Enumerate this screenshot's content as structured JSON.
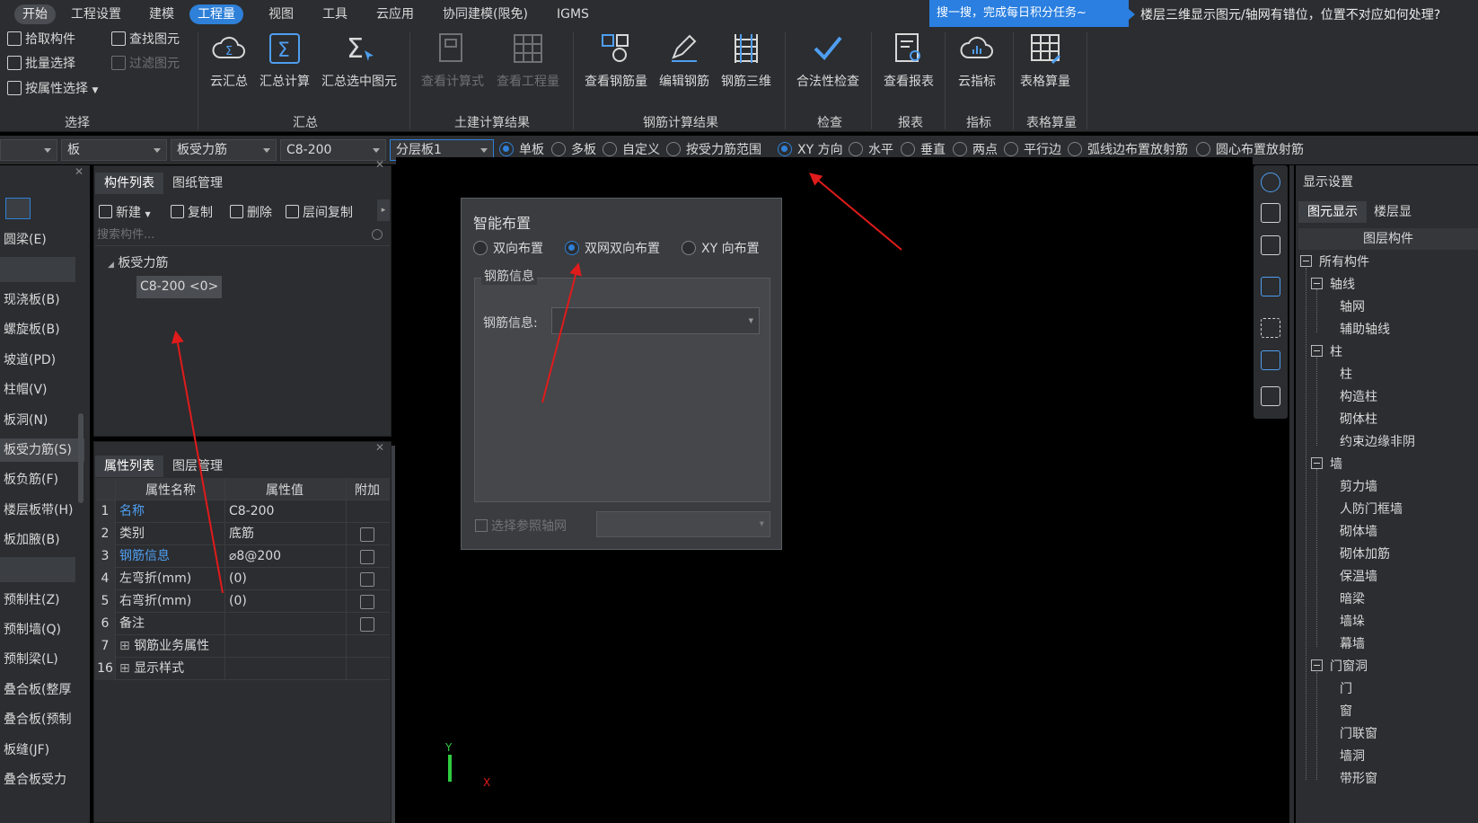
{
  "menubar": {
    "items": [
      "开始",
      "工程设置",
      "建模",
      "工程量",
      "视图",
      "工具",
      "云应用",
      "协同建模(限免)",
      "IGMS"
    ],
    "active": "工程量",
    "search_tip": "搜一搜，完成每日积分任务~",
    "question_text": "楼层三维显示图元/轴网有错位，位置不对应如何处理?"
  },
  "ribbon": {
    "select": {
      "pick": "拾取构件",
      "batch": "批量选择",
      "by_attr": "按属性选择",
      "find": "查找图元",
      "filter": "过滤图元",
      "label": "选择"
    },
    "summary": {
      "cloud": "云汇总",
      "calc": "汇总计算",
      "selected": "汇总选中图元",
      "label": "汇总"
    },
    "civil": {
      "formula": "查看计算式",
      "quantity": "查看工程量",
      "label": "土建计算结果"
    },
    "rebar": {
      "view_amount": "查看钢筋量",
      "edit": "编辑钢筋",
      "three_d": "钢筋三维",
      "label": "钢筋计算结果"
    },
    "check": {
      "legal": "合法性检查",
      "label": "检查"
    },
    "report": {
      "view": "查看报表",
      "label": "报表"
    },
    "index": {
      "cloud": "云指标",
      "label": "指标"
    },
    "table": {
      "calc": "表格算量",
      "label": "表格算量"
    }
  },
  "toolbar": {
    "combos": [
      "",
      "板",
      "板受力筋",
      "C8-200",
      "分层板1"
    ],
    "radios": [
      "单板",
      "多板",
      "自定义",
      "按受力筋范围",
      "XY 方向",
      "水平",
      "垂直",
      "两点",
      "平行边",
      "弧线边布置放射筋",
      "圆心布置放射筋"
    ],
    "radio_selected": [
      0,
      4
    ]
  },
  "leftnav": {
    "items": [
      "圆梁(E)",
      "现浇板(B)",
      "螺旋板(B)",
      "坡道(PD)",
      "柱帽(V)",
      "板洞(N)",
      "板受力筋(S)",
      "板负筋(F)",
      "楼层板带(H)",
      "板加腋(B)",
      "预制柱(Z)",
      "预制墙(Q)",
      "预制梁(L)",
      "叠合板(整厚",
      "叠合板(预制",
      "板缝(JF)",
      "叠合板受力"
    ],
    "selected": "板受力筋(S)"
  },
  "component_panel": {
    "tabs": [
      "构件列表",
      "图纸管理"
    ],
    "actions": {
      "new": "新建",
      "copy": "复制",
      "delete": "删除",
      "floor_copy": "层间复制"
    },
    "search_placeholder": "搜索构件...",
    "tree_root": "板受力筋",
    "tree_item": "C8-200 <0>"
  },
  "property_panel": {
    "tabs": [
      "属性列表",
      "图层管理"
    ],
    "headers": {
      "name": "属性名称",
      "value": "属性值",
      "extra": "附加"
    },
    "rows": [
      {
        "no": "1",
        "name": "名称",
        "value": "C8-200",
        "blue": true,
        "check": false
      },
      {
        "no": "2",
        "name": "类别",
        "value": "底筋",
        "blue": false,
        "check": true
      },
      {
        "no": "3",
        "name": "钢筋信息",
        "value": "⌀8@200",
        "blue": true,
        "check": true
      },
      {
        "no": "4",
        "name": "左弯折(mm)",
        "value": "(0)",
        "blue": false,
        "check": true
      },
      {
        "no": "5",
        "name": "右弯折(mm)",
        "value": "(0)",
        "blue": false,
        "check": true
      },
      {
        "no": "6",
        "name": "备注",
        "value": "",
        "blue": false,
        "check": true
      },
      {
        "no": "7",
        "name": "钢筋业务属性",
        "value": "",
        "blue": false,
        "check": false,
        "expand": true
      },
      {
        "no": "16",
        "name": "显示样式",
        "value": "",
        "blue": false,
        "check": false,
        "expand": true
      }
    ]
  },
  "dialog": {
    "title": "智能布置",
    "options": [
      "双向布置",
      "双网双向布置",
      "XY 向布置"
    ],
    "selected": "双网双向布置",
    "group_title": "钢筋信息",
    "field_label": "钢筋信息:",
    "field_value": "",
    "ref_axis_label": "选择参照轴网"
  },
  "display_panel": {
    "title": "显示设置",
    "tabs": [
      "图元显示",
      "楼层显"
    ],
    "column_header": "图层构件",
    "tree": [
      {
        "label": "所有构件",
        "level": 0,
        "box": true
      },
      {
        "label": "轴线",
        "level": 1,
        "box": true
      },
      {
        "label": "轴网",
        "level": 2
      },
      {
        "label": "辅助轴线",
        "level": 2
      },
      {
        "label": "柱",
        "level": 1,
        "box": true
      },
      {
        "label": "柱",
        "level": 2
      },
      {
        "label": "构造柱",
        "level": 2
      },
      {
        "label": "砌体柱",
        "level": 2
      },
      {
        "label": "约束边缘非阴",
        "level": 2
      },
      {
        "label": "墙",
        "level": 1,
        "box": true
      },
      {
        "label": "剪力墙",
        "level": 2
      },
      {
        "label": "人防门框墙",
        "level": 2
      },
      {
        "label": "砌体墙",
        "level": 2
      },
      {
        "label": "砌体加筋",
        "level": 2
      },
      {
        "label": "保温墙",
        "level": 2
      },
      {
        "label": "暗梁",
        "level": 2
      },
      {
        "label": "墙垛",
        "level": 2
      },
      {
        "label": "幕墙",
        "level": 2
      },
      {
        "label": "门窗洞",
        "level": 1,
        "box": true
      },
      {
        "label": "门",
        "level": 2
      },
      {
        "label": "窗",
        "level": 2
      },
      {
        "label": "门联窗",
        "level": 2
      },
      {
        "label": "墙洞",
        "level": 2
      },
      {
        "label": "带形窗",
        "level": 2
      }
    ]
  },
  "axis": {
    "y": "Y",
    "x": "X"
  },
  "colors": {
    "accent": "#2f80d8",
    "annotation": "#e01b1b",
    "background": "#000000",
    "panel": "#2b2d30"
  }
}
